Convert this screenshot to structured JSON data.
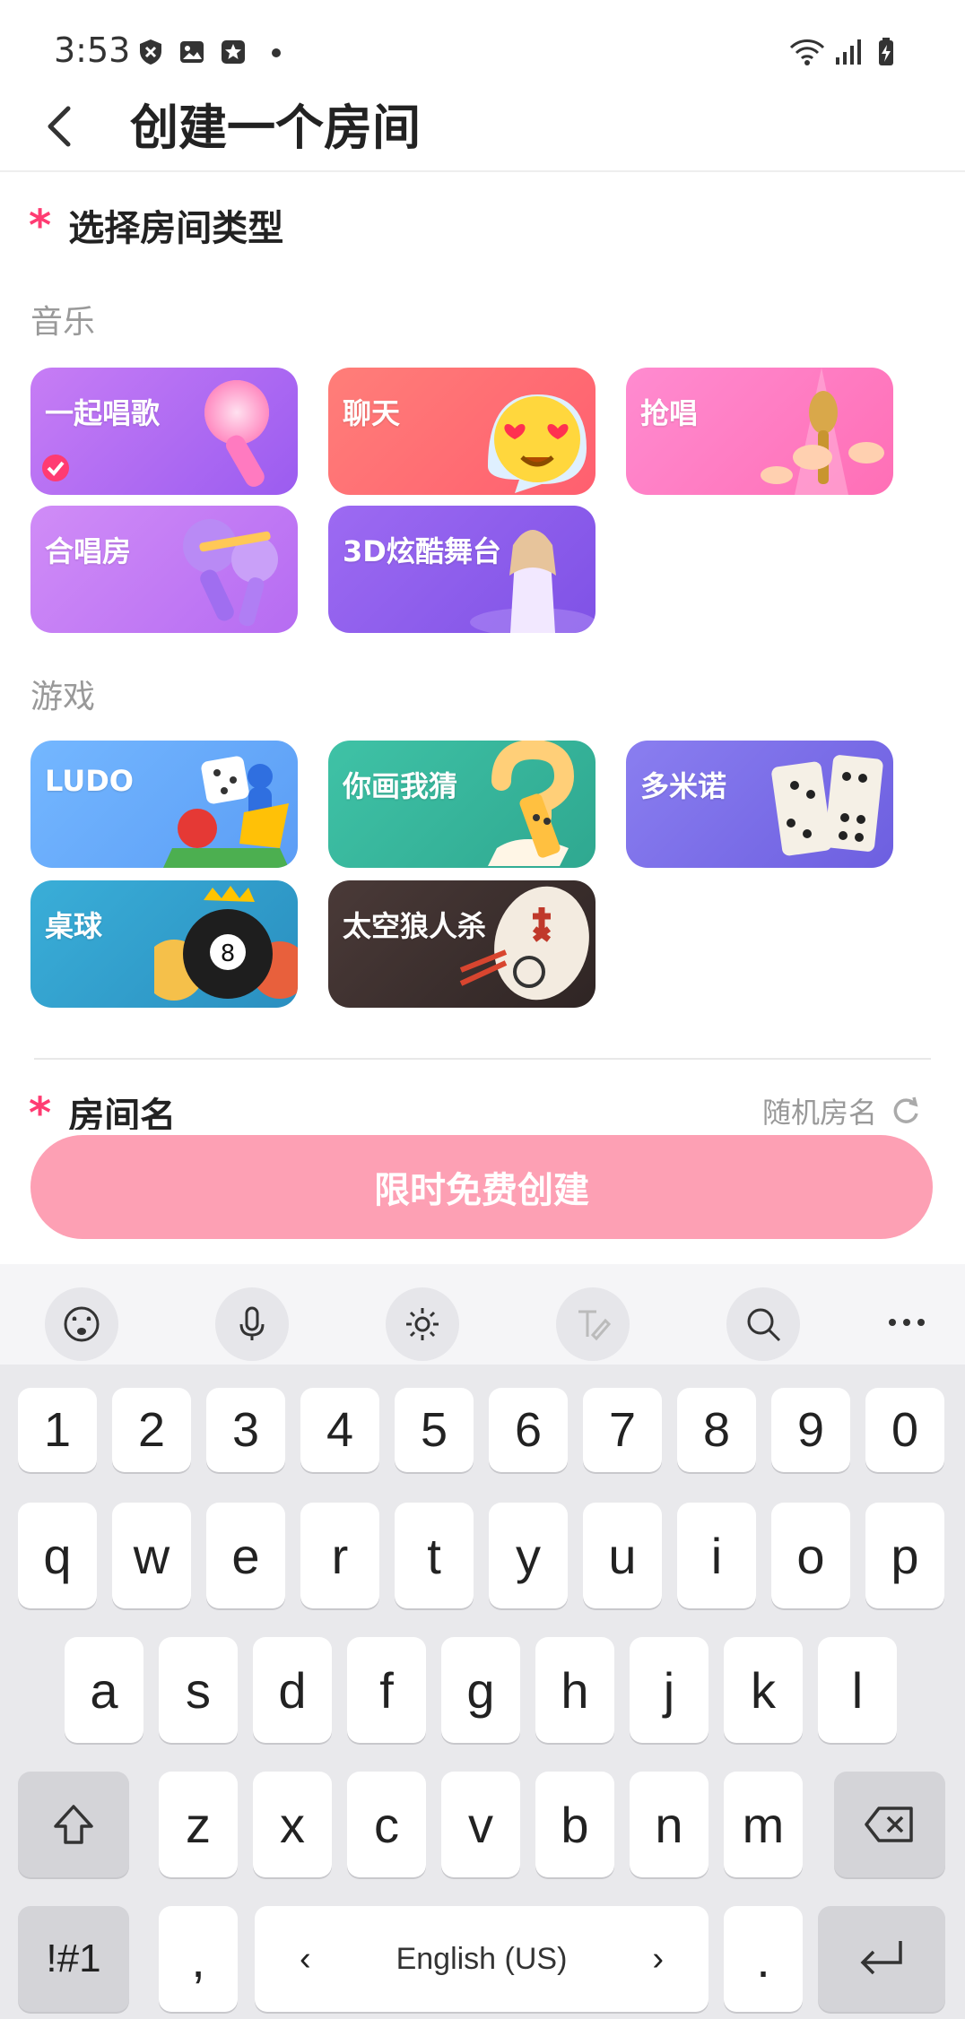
{
  "status_bar": {
    "time": "3:53",
    "icons": [
      "shield-x-icon",
      "image-icon",
      "star-badge-icon",
      "dot-icon",
      "wifi-icon",
      "signal-icon",
      "battery-charging-icon"
    ]
  },
  "header": {
    "title": "创建一个房间",
    "back_icon": "back-arrow-icon"
  },
  "room_type": {
    "title": "选择房间类型",
    "groups": [
      {
        "title": "音乐",
        "items": [
          {
            "label": "一起唱歌",
            "selected": true,
            "color_start": "#c77df5",
            "color_end": "#9b5cf0",
            "icon": "microphone-icon"
          },
          {
            "label": "聊天",
            "selected": false,
            "color_start": "#ff7e79",
            "color_end": "#ff5f6f",
            "icon": "heart-eyes-emoji-icon"
          },
          {
            "label": "抢唱",
            "selected": false,
            "color_start": "#ff8bd0",
            "color_end": "#ff6fb6",
            "icon": "golden-mic-hands-icon"
          },
          {
            "label": "合唱房",
            "selected": false,
            "color_start": "#d08cf7",
            "color_end": "#b66cf2",
            "icon": "double-mic-icon"
          },
          {
            "label": "3D炫酷舞台",
            "selected": false,
            "color_start": "#9d6af2",
            "color_end": "#7f52e6",
            "icon": "singer-avatar-icon"
          }
        ]
      },
      {
        "title": "游戏",
        "items": [
          {
            "label": "LUDO",
            "selected": false,
            "color_start": "#74b7ff",
            "color_end": "#5b9df5",
            "icon": "ludo-dice-icon"
          },
          {
            "label": "你画我猜",
            "selected": false,
            "color_start": "#3fc2a6",
            "color_end": "#2fa890",
            "icon": "pencil-question-icon"
          },
          {
            "label": "多米诺",
            "selected": false,
            "color_start": "#8a7ef0",
            "color_end": "#6d5fe0",
            "icon": "domino-icon"
          },
          {
            "label": "桌球",
            "selected": false,
            "color_start": "#3aaed8",
            "color_end": "#2a8fc0",
            "icon": "billiard-ball-icon"
          },
          {
            "label": "太空狼人杀",
            "selected": false,
            "color_start": "#4a3a38",
            "color_end": "#2f2524",
            "icon": "werewolf-mask-icon"
          }
        ]
      }
    ]
  },
  "room_name": {
    "title": "房间名",
    "random_label": "随机房名"
  },
  "create_button": {
    "label": "限时免费创建"
  },
  "keyboard_toolbar": [
    "emoji-icon",
    "microphone-icon",
    "settings-icon",
    "handwriting-icon",
    "search-icon",
    "more-icon"
  ],
  "keyboard": {
    "row_numbers": [
      "1",
      "2",
      "3",
      "4",
      "5",
      "6",
      "7",
      "8",
      "9",
      "0"
    ],
    "row1": [
      "q",
      "w",
      "e",
      "r",
      "t",
      "y",
      "u",
      "i",
      "o",
      "p"
    ],
    "row2": [
      "a",
      "s",
      "d",
      "f",
      "g",
      "h",
      "j",
      "k",
      "l"
    ],
    "row3": [
      "z",
      "x",
      "c",
      "v",
      "b",
      "n",
      "m"
    ],
    "symbols_key": "!#1",
    "comma_key": ",",
    "space_label": "English (US)",
    "period_key": "."
  }
}
